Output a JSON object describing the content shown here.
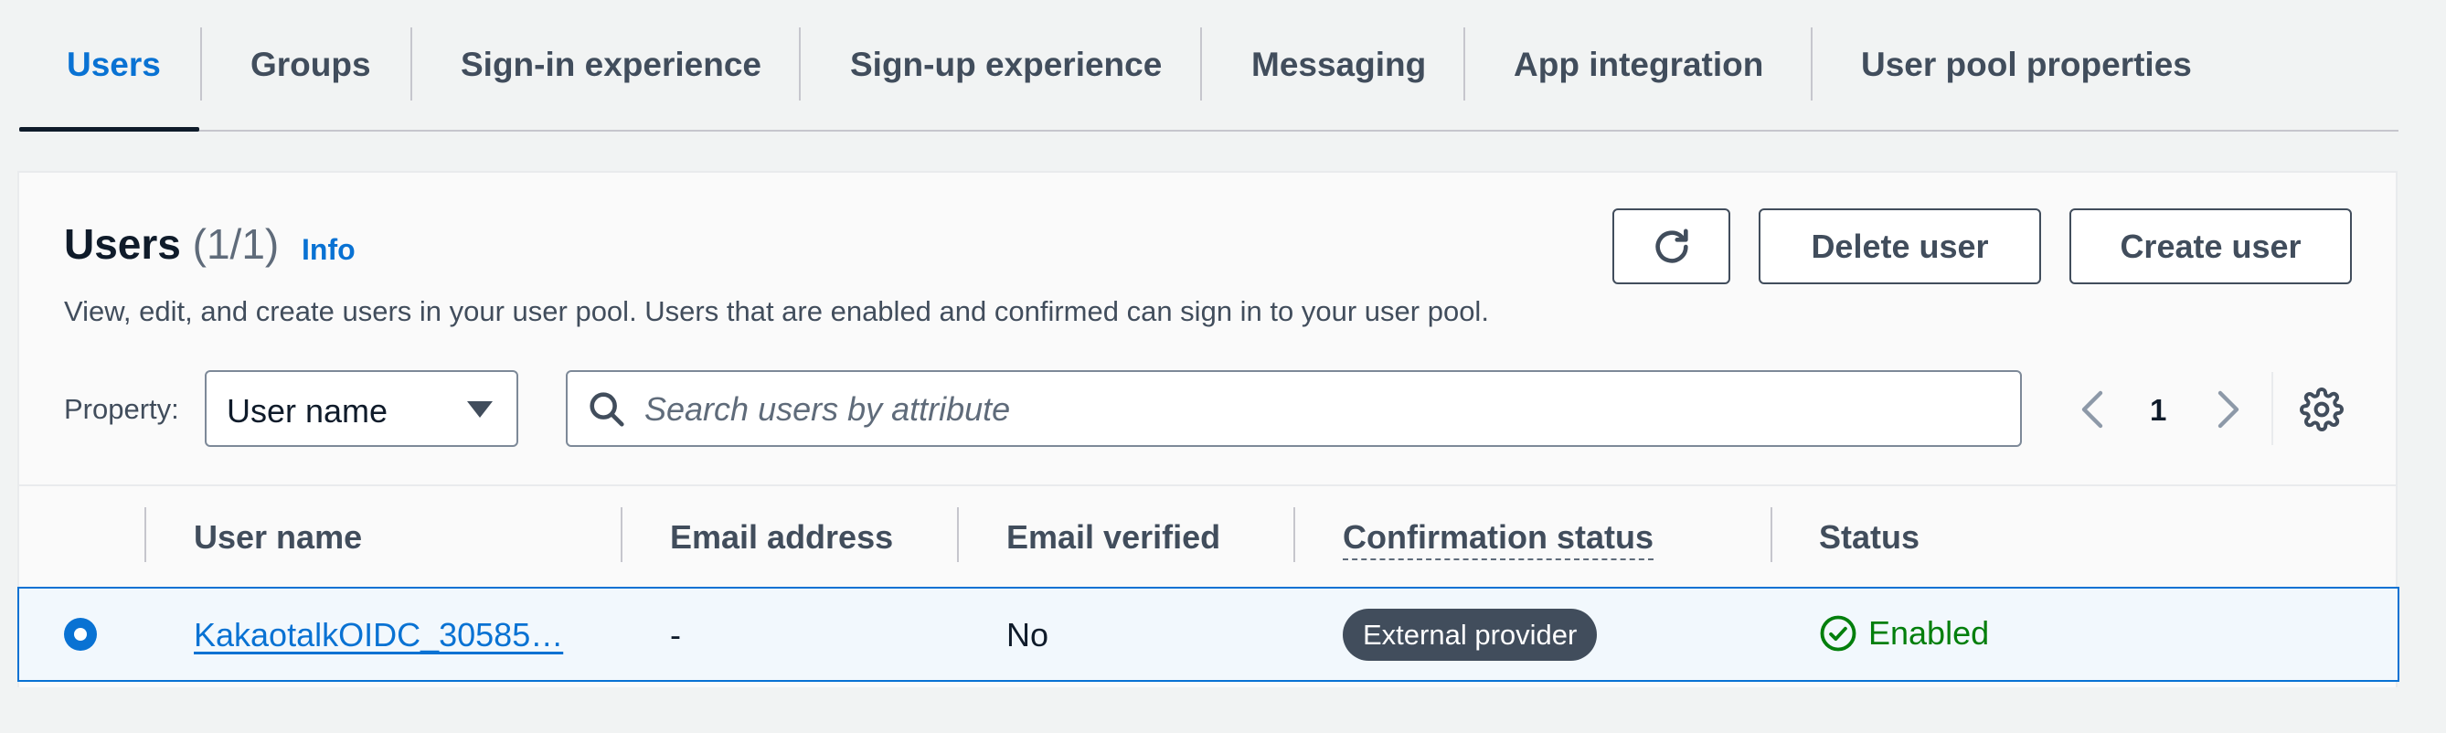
{
  "tabs": [
    {
      "label": "Users"
    },
    {
      "label": "Groups"
    },
    {
      "label": "Sign-in experience"
    },
    {
      "label": "Sign-up experience"
    },
    {
      "label": "Messaging"
    },
    {
      "label": "App integration"
    },
    {
      "label": "User pool properties"
    }
  ],
  "panel": {
    "title": "Users",
    "count": "(1/1)",
    "info": "Info",
    "description": "View, edit, and create users in your user pool. Users that are enabled and confirmed can sign in to your user pool.",
    "refresh_icon": "refresh-icon",
    "delete_label": "Delete user",
    "create_label": "Create user"
  },
  "filter": {
    "property_label": "Property:",
    "property_value": "User name",
    "search_placeholder": "Search users by attribute",
    "search_icon": "search-icon"
  },
  "pagination": {
    "current_page": "1",
    "settings_icon": "gear-icon"
  },
  "table": {
    "columns": [
      "User name",
      "Email address",
      "Email verified",
      "Confirmation status",
      "Status"
    ],
    "rows": [
      {
        "selected": true,
        "user_name": "KakaotalkOIDC_30585…",
        "email": "-",
        "email_verified": "No",
        "confirmation_status": "External provider",
        "status": "Enabled"
      }
    ]
  },
  "colors": {
    "accent": "#0972d3",
    "success": "#037f0c",
    "badge": "#414d5c"
  }
}
